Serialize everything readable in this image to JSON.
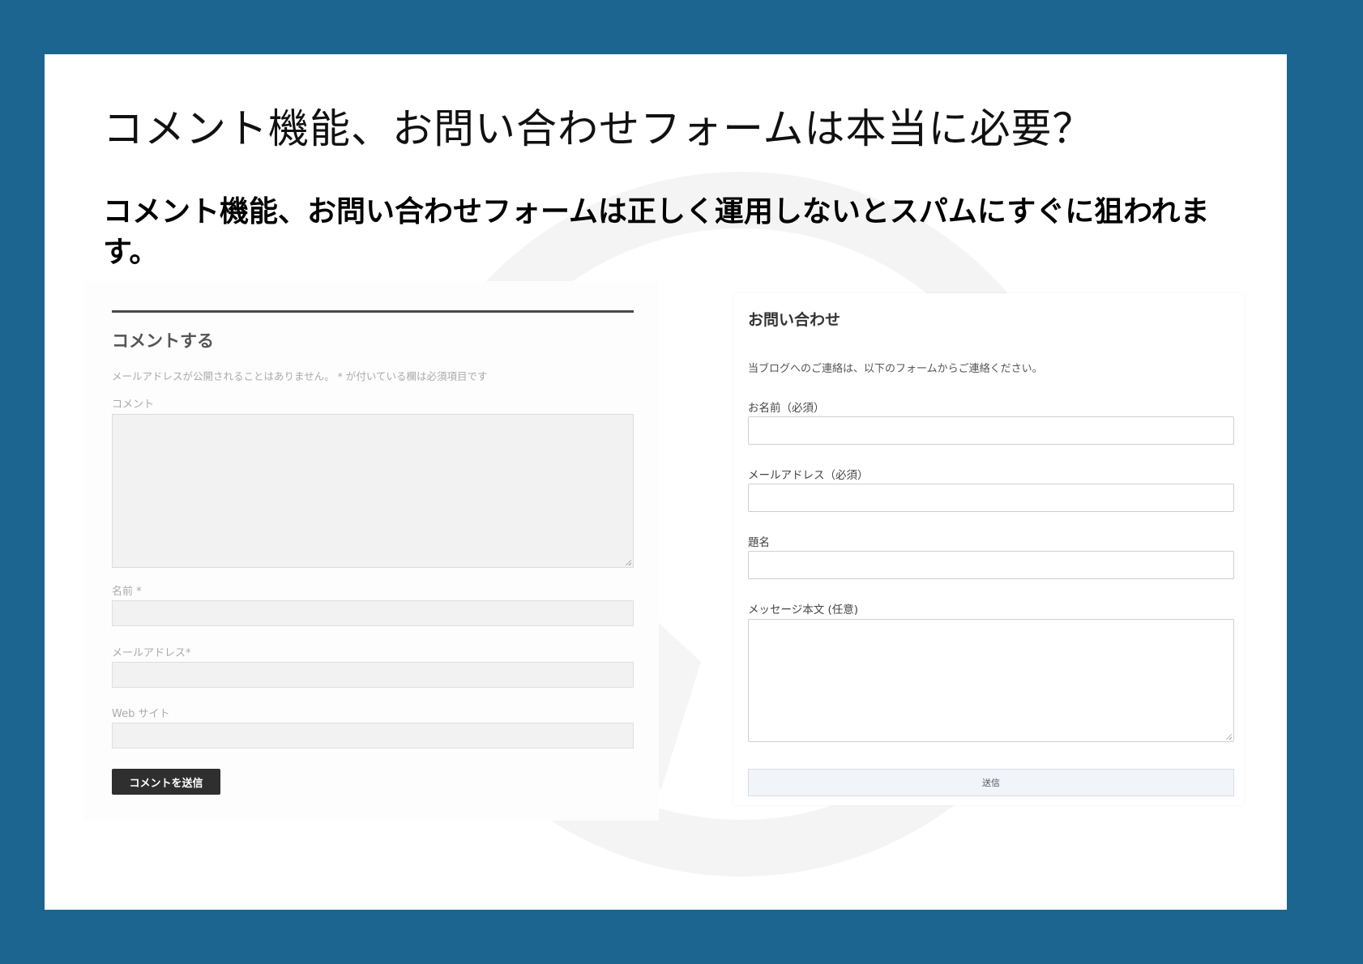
{
  "slide": {
    "title": "コメント機能、お問い合わせフォームは本当に必要？",
    "subtitle": "コメント機能、お問い合わせフォームは正しく運用しないとスパムにすぐに狙われます。"
  },
  "comment_form": {
    "heading": "コメントする",
    "note": "メールアドレスが公開されることはありません。 * が付いている欄は必須項目です",
    "comment_label": "コメント",
    "name_label": "名前 *",
    "email_label": "メールアドレス*",
    "website_label": "Web サイト",
    "submit_label": "コメントを送信"
  },
  "contact_form": {
    "heading": "お問い合わせ",
    "intro": "当ブログへのご連絡は、以下のフォームからご連絡ください。",
    "name_label": "お名前（必須）",
    "email_label": "メールアドレス（必須）",
    "subject_label": "題名",
    "message_label": "メッセージ本文 (任意)",
    "submit_label": "送信"
  },
  "colors": {
    "background": "#1c6590",
    "panel": "#ffffff",
    "comment_button": "#2f2f2f"
  }
}
